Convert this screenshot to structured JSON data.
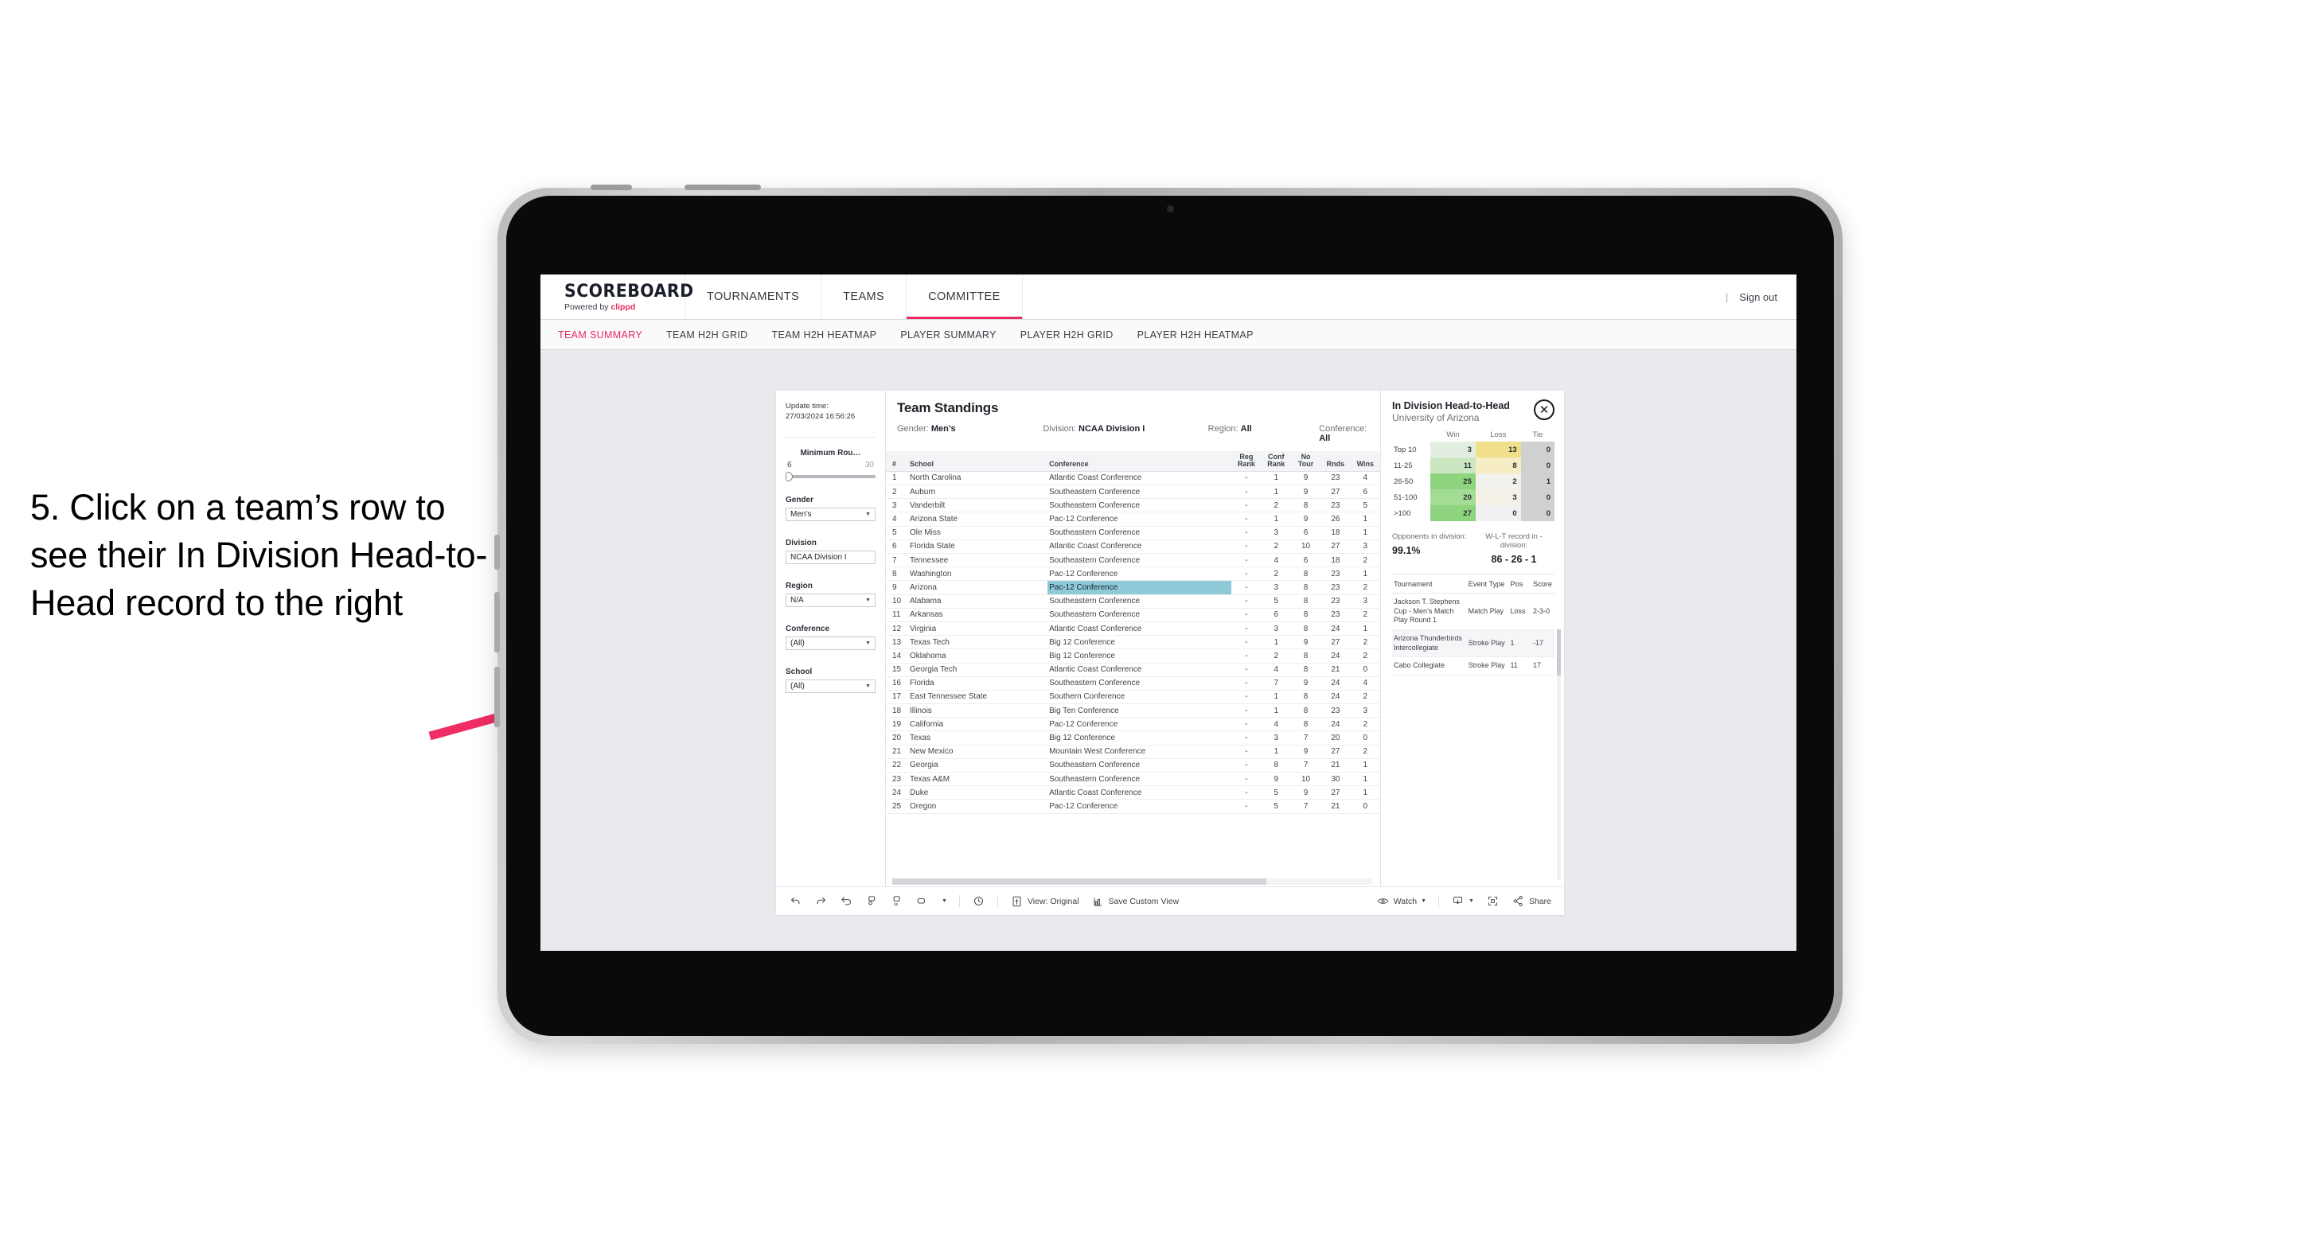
{
  "annotation": {
    "text": "5. Click on a team’s row to see their In Division Head-to-Head record to the right",
    "arrow_color": "#ef2d63"
  },
  "header": {
    "brand_title": "SCOREBOARD",
    "brand_sub_prefix": "Powered by ",
    "brand_sub_name": "clippd",
    "nav": [
      {
        "label": "TOURNAMENTS",
        "active": false
      },
      {
        "label": "TEAMS",
        "active": false
      },
      {
        "label": "COMMITTEE",
        "active": true
      }
    ],
    "divider": "|",
    "sign_out": "Sign out",
    "accent": "#ea2a5f"
  },
  "subnav": {
    "items": [
      {
        "label": "TEAM SUMMARY",
        "active": true
      },
      {
        "label": "TEAM H2H GRID",
        "active": false
      },
      {
        "label": "TEAM H2H HEATMAP",
        "active": false
      },
      {
        "label": "PLAYER SUMMARY",
        "active": false
      },
      {
        "label": "PLAYER H2H GRID",
        "active": false
      },
      {
        "label": "PLAYER H2H HEATMAP",
        "active": false
      }
    ]
  },
  "filters": {
    "update_time_label": "Update time:",
    "update_time_value": "27/03/2024 16:56:26",
    "slider": {
      "label": "Minimum Rou…",
      "min": "6",
      "max": "30",
      "value_pct": 4
    },
    "groups": [
      {
        "label": "Gender",
        "value": "Men’s"
      },
      {
        "label": "Division",
        "value": "NCAA Division I"
      },
      {
        "label": "Region",
        "value": "N/A"
      },
      {
        "label": "Conference",
        "value": "(All)"
      },
      {
        "label": "School",
        "value": "(All)"
      }
    ]
  },
  "standings": {
    "title": "Team Standings",
    "meta": [
      {
        "label": "Gender:",
        "value": "Men’s"
      },
      {
        "label": "Division:",
        "value": "NCAA Division I"
      },
      {
        "label": "Region:",
        "value": "All"
      },
      {
        "label": "Conference:",
        "value": "All"
      }
    ],
    "columns": [
      "#",
      "School",
      "Conference",
      "Reg Rank",
      "Conf Rank",
      "No Tour",
      "Rnds",
      "Wins"
    ],
    "columns_wrapped": [
      {
        "l1": "#",
        "l2": ""
      },
      {
        "l1": "School",
        "l2": ""
      },
      {
        "l1": "Conference",
        "l2": ""
      },
      {
        "l1": "Reg",
        "l2": "Rank"
      },
      {
        "l1": "Conf",
        "l2": "Rank"
      },
      {
        "l1": "No",
        "l2": "Tour"
      },
      {
        "l1": "Rnds",
        "l2": ""
      },
      {
        "l1": "Wins",
        "l2": ""
      }
    ],
    "selected_row_index": 8,
    "selected_highlight_color": "#8ecad7",
    "rows": [
      {
        "n": "1",
        "school": "North Carolina",
        "conf": "Atlantic Coast Conference",
        "reg": "-",
        "confrank": "1",
        "notour": "9",
        "rnds": "23",
        "wins": "4"
      },
      {
        "n": "2",
        "school": "Auburn",
        "conf": "Southeastern Conference",
        "reg": "-",
        "confrank": "1",
        "notour": "9",
        "rnds": "27",
        "wins": "6"
      },
      {
        "n": "3",
        "school": "Vanderbilt",
        "conf": "Southeastern Conference",
        "reg": "-",
        "confrank": "2",
        "notour": "8",
        "rnds": "23",
        "wins": "5"
      },
      {
        "n": "4",
        "school": "Arizona State",
        "conf": "Pac-12 Conference",
        "reg": "-",
        "confrank": "1",
        "notour": "9",
        "rnds": "26",
        "wins": "1"
      },
      {
        "n": "5",
        "school": "Ole Miss",
        "conf": "Southeastern Conference",
        "reg": "-",
        "confrank": "3",
        "notour": "6",
        "rnds": "18",
        "wins": "1"
      },
      {
        "n": "6",
        "school": "Florida State",
        "conf": "Atlantic Coast Conference",
        "reg": "-",
        "confrank": "2",
        "notour": "10",
        "rnds": "27",
        "wins": "3"
      },
      {
        "n": "7",
        "school": "Tennessee",
        "conf": "Southeastern Conference",
        "reg": "-",
        "confrank": "4",
        "notour": "6",
        "rnds": "18",
        "wins": "2"
      },
      {
        "n": "8",
        "school": "Washington",
        "conf": "Pac-12 Conference",
        "reg": "-",
        "confrank": "2",
        "notour": "8",
        "rnds": "23",
        "wins": "1"
      },
      {
        "n": "9",
        "school": "Arizona",
        "conf": "Pac-12 Conference",
        "reg": "-",
        "confrank": "3",
        "notour": "8",
        "rnds": "23",
        "wins": "2"
      },
      {
        "n": "10",
        "school": "Alabama",
        "conf": "Southeastern Conference",
        "reg": "-",
        "confrank": "5",
        "notour": "8",
        "rnds": "23",
        "wins": "3"
      },
      {
        "n": "11",
        "school": "Arkansas",
        "conf": "Southeastern Conference",
        "reg": "-",
        "confrank": "6",
        "notour": "8",
        "rnds": "23",
        "wins": "2"
      },
      {
        "n": "12",
        "school": "Virginia",
        "conf": "Atlantic Coast Conference",
        "reg": "-",
        "confrank": "3",
        "notour": "8",
        "rnds": "24",
        "wins": "1"
      },
      {
        "n": "13",
        "school": "Texas Tech",
        "conf": "Big 12 Conference",
        "reg": "-",
        "confrank": "1",
        "notour": "9",
        "rnds": "27",
        "wins": "2"
      },
      {
        "n": "14",
        "school": "Oklahoma",
        "conf": "Big 12 Conference",
        "reg": "-",
        "confrank": "2",
        "notour": "8",
        "rnds": "24",
        "wins": "2"
      },
      {
        "n": "15",
        "school": "Georgia Tech",
        "conf": "Atlantic Coast Conference",
        "reg": "-",
        "confrank": "4",
        "notour": "8",
        "rnds": "21",
        "wins": "0"
      },
      {
        "n": "16",
        "school": "Florida",
        "conf": "Southeastern Conference",
        "reg": "-",
        "confrank": "7",
        "notour": "9",
        "rnds": "24",
        "wins": "4"
      },
      {
        "n": "17",
        "school": "East Tennessee State",
        "conf": "Southern Conference",
        "reg": "-",
        "confrank": "1",
        "notour": "8",
        "rnds": "24",
        "wins": "2"
      },
      {
        "n": "18",
        "school": "Illinois",
        "conf": "Big Ten Conference",
        "reg": "-",
        "confrank": "1",
        "notour": "8",
        "rnds": "23",
        "wins": "3"
      },
      {
        "n": "19",
        "school": "California",
        "conf": "Pac-12 Conference",
        "reg": "-",
        "confrank": "4",
        "notour": "8",
        "rnds": "24",
        "wins": "2"
      },
      {
        "n": "20",
        "school": "Texas",
        "conf": "Big 12 Conference",
        "reg": "-",
        "confrank": "3",
        "notour": "7",
        "rnds": "20",
        "wins": "0"
      },
      {
        "n": "21",
        "school": "New Mexico",
        "conf": "Mountain West Conference",
        "reg": "-",
        "confrank": "1",
        "notour": "9",
        "rnds": "27",
        "wins": "2"
      },
      {
        "n": "22",
        "school": "Georgia",
        "conf": "Southeastern Conference",
        "reg": "-",
        "confrank": "8",
        "notour": "7",
        "rnds": "21",
        "wins": "1"
      },
      {
        "n": "23",
        "school": "Texas A&M",
        "conf": "Southeastern Conference",
        "reg": "-",
        "confrank": "9",
        "notour": "10",
        "rnds": "30",
        "wins": "1"
      },
      {
        "n": "24",
        "school": "Duke",
        "conf": "Atlantic Coast Conference",
        "reg": "-",
        "confrank": "5",
        "notour": "9",
        "rnds": "27",
        "wins": "1"
      },
      {
        "n": "25",
        "school": "Oregon",
        "conf": "Pac-12 Conference",
        "reg": "-",
        "confrank": "5",
        "notour": "7",
        "rnds": "21",
        "wins": "0"
      }
    ]
  },
  "detail": {
    "title": "In Division Head-to-Head",
    "subtitle": "University of Arizona",
    "close_icon": "✕",
    "h2h": {
      "columns": [
        "",
        "Win",
        "Loss",
        "Tie"
      ],
      "rows": [
        {
          "label": "Top 10",
          "win": "3",
          "loss": "13",
          "tie": "0",
          "win_color": "#e2efe0",
          "loss_color": "#f0e08c",
          "tie_color": "#d0d0d0"
        },
        {
          "label": "11-25",
          "win": "11",
          "loss": "8",
          "tie": "0",
          "win_color": "#cbe7c2",
          "loss_color": "#f6edc4",
          "tie_color": "#d0d0d0"
        },
        {
          "label": "26-50",
          "win": "25",
          "loss": "2",
          "tie": "1",
          "win_color": "#8ed47f",
          "loss_color": "#f2f1ec",
          "tie_color": "#d0d0d0"
        },
        {
          "label": "51-100",
          "win": "20",
          "loss": "3",
          "tie": "0",
          "win_color": "#a3dc94",
          "loss_color": "#f4f0e6",
          "tie_color": "#d0d0d0"
        },
        {
          "label": ">100",
          "win": "27",
          "loss": "0",
          "tie": "0",
          "win_color": "#8ed47f",
          "loss_color": "#f1f1f1",
          "tie_color": "#d0d0d0"
        }
      ]
    },
    "stats": [
      {
        "label": "Opponents in division:",
        "value": "99.1%"
      },
      {
        "label": "W-L-T record in -division:",
        "value": "86 - 26 - 1"
      }
    ],
    "tours": {
      "columns": [
        "Tournament",
        "Event Type",
        "Pos",
        "Score"
      ],
      "rows": [
        {
          "tournament": "Jackson T. Stephens Cup - Men’s Match Play Round 1",
          "event": "Match Play",
          "pos": "Loss",
          "score": "2-3-0"
        },
        {
          "tournament": "Arizona Thunderbirds Intercollegiate",
          "event": "Stroke Play",
          "pos": "1",
          "score": "-17"
        },
        {
          "tournament": "Cabo Collegiate",
          "event": "Stroke Play",
          "pos": "11",
          "score": "17"
        }
      ]
    }
  },
  "toolbar": {
    "view_label": "View: Original",
    "save_label": "Save Custom View",
    "watch_label": "Watch",
    "share_label": "Share"
  }
}
